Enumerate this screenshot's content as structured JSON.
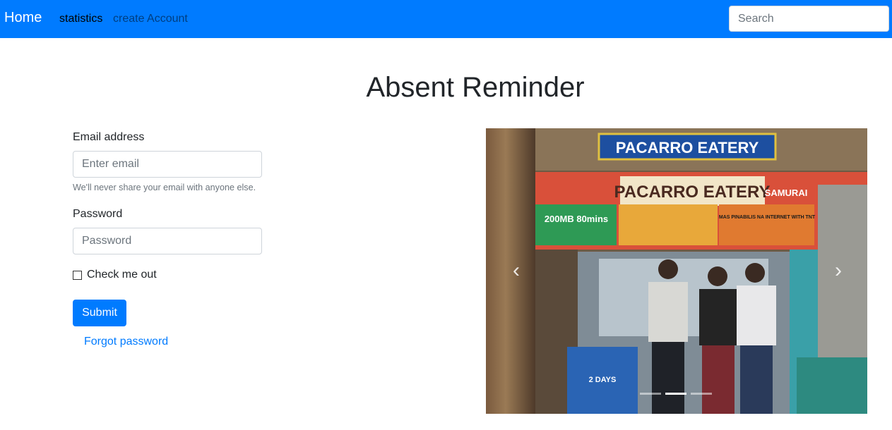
{
  "navbar": {
    "brand": "Home",
    "links": [
      "statistics",
      "create Account"
    ],
    "search_placeholder": "Search"
  },
  "page_title": "Absent Reminder",
  "form": {
    "email_label": "Email address",
    "email_placeholder": "Enter email",
    "email_help": "We'll never share your email with anyone else.",
    "password_label": "Password",
    "password_placeholder": "Password",
    "checkbox_label": "Check me out",
    "submit_label": "Submit",
    "forgot_link": "Forgot password"
  },
  "carousel": {
    "signs": {
      "top": "PACARRO EATERY",
      "banner": "PACARRO EATERY",
      "brand": "SAMURAI",
      "promo_data": "200MB 80mins",
      "promo_net": "MAS PINABILIS NA INTERNET WITH TNT",
      "promo_days": "2 DAYS"
    },
    "indicators": 3,
    "active_index": 1,
    "colors": {
      "accent": "#007bff"
    }
  }
}
